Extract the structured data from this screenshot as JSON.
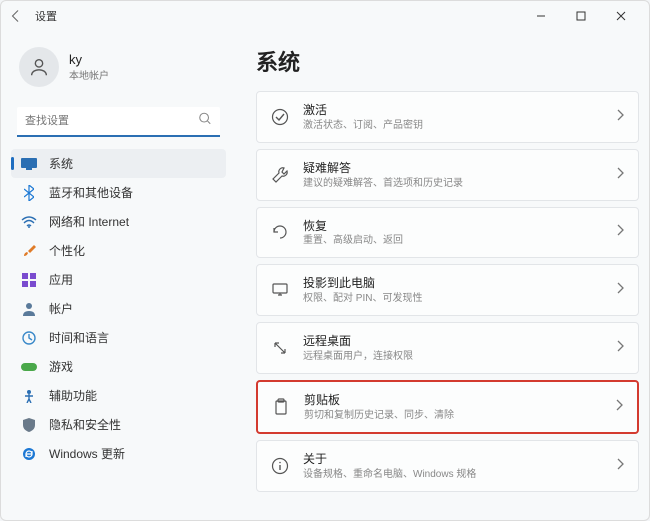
{
  "titlebar": {
    "title": "设置"
  },
  "account": {
    "name": "ky",
    "sub": "本地帐户"
  },
  "search": {
    "placeholder": "查找设置"
  },
  "nav": {
    "items": [
      {
        "label": "系统",
        "icon": "system",
        "color": "#2b6fb3",
        "selected": true
      },
      {
        "label": "蓝牙和其他设备",
        "icon": "bluetooth",
        "color": "#1c78d4"
      },
      {
        "label": "网络和 Internet",
        "icon": "wifi",
        "color": "#2b6fb3"
      },
      {
        "label": "个性化",
        "icon": "brush",
        "color": "#e07b28"
      },
      {
        "label": "应用",
        "icon": "apps",
        "color": "#7a4bcf"
      },
      {
        "label": "帐户",
        "icon": "user",
        "color": "#5a7a9a"
      },
      {
        "label": "时间和语言",
        "icon": "clock",
        "color": "#3a89c9"
      },
      {
        "label": "游戏",
        "icon": "game",
        "color": "#4aa84a"
      },
      {
        "label": "辅助功能",
        "icon": "access",
        "color": "#2b6fb3"
      },
      {
        "label": "隐私和安全性",
        "icon": "privacy",
        "color": "#6a7a8a"
      },
      {
        "label": "Windows 更新",
        "icon": "update",
        "color": "#1c78d4"
      }
    ]
  },
  "main": {
    "title": "系统",
    "cards": [
      {
        "title": "激活",
        "sub": "激活状态、订阅、产品密钥",
        "icon": "check"
      },
      {
        "title": "疑难解答",
        "sub": "建议的疑难解答、首选项和历史记录",
        "icon": "wrench"
      },
      {
        "title": "恢复",
        "sub": "重置、高级启动、返回",
        "icon": "recover"
      },
      {
        "title": "投影到此电脑",
        "sub": "权限、配对 PIN、可发现性",
        "icon": "project"
      },
      {
        "title": "远程桌面",
        "sub": "远程桌面用户，连接权限",
        "icon": "remote"
      },
      {
        "title": "剪贴板",
        "sub": "剪切和复制历史记录、同步、清除",
        "icon": "clipboard",
        "highlighted": true
      },
      {
        "title": "关于",
        "sub": "设备规格、重命名电脑、Windows 规格",
        "icon": "info"
      }
    ]
  }
}
